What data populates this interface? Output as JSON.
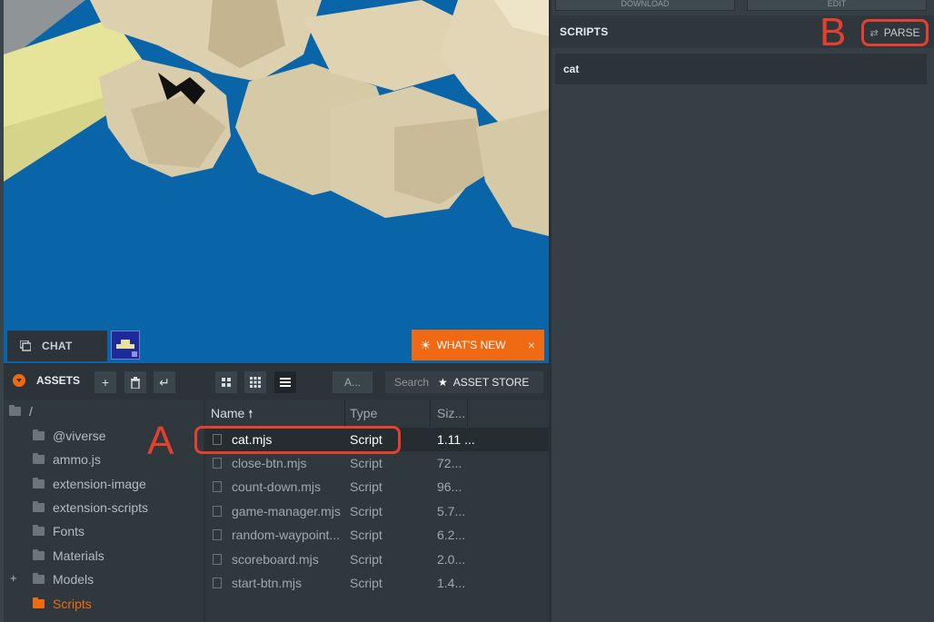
{
  "viewport": {
    "chat_label": "CHAT",
    "whats_new_label": "WHAT'S NEW",
    "whats_new_close": "×"
  },
  "right_panel": {
    "top_buttons": [
      "DOWNLOAD",
      "EDIT"
    ],
    "scripts_title": "SCRIPTS",
    "parse_label": "PARSE",
    "script_items": [
      "cat"
    ],
    "annotation": "B"
  },
  "assets": {
    "title": "ASSETS",
    "type_filter": "A...",
    "search_placeholder": "Search",
    "asset_store_label": "ASSET STORE",
    "tree": {
      "root": "/",
      "folders": [
        "@viverse",
        "ammo.js",
        "extension-image",
        "extension-scripts",
        "Fonts",
        "Materials",
        "Models",
        "Scripts"
      ],
      "selected": "Scripts",
      "expandable": "Models"
    },
    "columns": {
      "name": "Name",
      "type": "Type",
      "size": "Siz..."
    },
    "files": [
      {
        "name": "cat.mjs",
        "type": "Script",
        "size": "1.11 ..."
      },
      {
        "name": "close-btn.mjs",
        "type": "Script",
        "size": "72..."
      },
      {
        "name": "count-down.mjs",
        "type": "Script",
        "size": "96..."
      },
      {
        "name": "game-manager.mjs",
        "type": "Script",
        "size": "5.7..."
      },
      {
        "name": "random-waypoint...",
        "type": "Script",
        "size": "6.2..."
      },
      {
        "name": "scoreboard.mjs",
        "type": "Script",
        "size": "2.0..."
      },
      {
        "name": "start-btn.mjs",
        "type": "Script",
        "size": "1.4..."
      }
    ],
    "annotation": "A"
  },
  "colors": {
    "accent": "#f06a13",
    "annotation": "#e5402f",
    "water": "#0a64a8",
    "rock": "#d9ccaa"
  }
}
